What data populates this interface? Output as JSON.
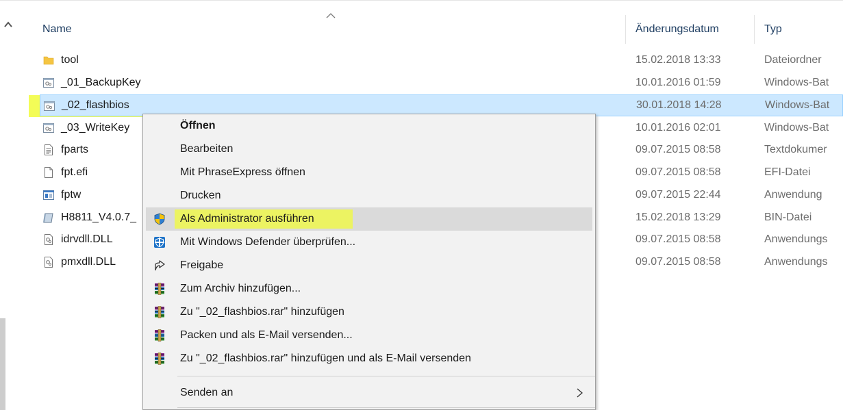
{
  "header": {
    "name": "Name",
    "date": "Änderungsdatum",
    "type": "Typ"
  },
  "files": [
    {
      "name": "tool",
      "date": "15.02.2018 13:33",
      "type": "Dateiordner",
      "icon": "folder-icon"
    },
    {
      "name": "_01_BackupKey",
      "date": "10.01.2016 01:59",
      "type": "Windows-Bat",
      "icon": "batch-file-icon"
    },
    {
      "name": "_02_flashbios",
      "date": "30.01.2018 14:28",
      "type": "Windows-Bat",
      "icon": "batch-file-icon",
      "selected": true
    },
    {
      "name": "_03_WriteKey",
      "date": "10.01.2016 02:01",
      "type": "Windows-Bat",
      "icon": "batch-file-icon"
    },
    {
      "name": "fparts",
      "date": "09.07.2015 08:58",
      "type": "Textdokumer",
      "icon": "text-file-icon"
    },
    {
      "name": "fpt.efi",
      "date": "09.07.2015 08:58",
      "type": "EFI-Datei",
      "icon": "blank-file-icon"
    },
    {
      "name": "fptw",
      "date": "09.07.2015 22:44",
      "type": "Anwendung",
      "icon": "application-icon"
    },
    {
      "name": "H8811_V4.0.7_",
      "date": "15.02.2018 13:29",
      "type": "BIN-Datei",
      "icon": "bin-file-icon"
    },
    {
      "name": "idrvdll.DLL",
      "date": "09.07.2015 08:58",
      "type": "Anwendungs",
      "icon": "dll-file-icon"
    },
    {
      "name": "pmxdll.DLL",
      "date": "09.07.2015 08:58",
      "type": "Anwendungs",
      "icon": "dll-file-icon"
    }
  ],
  "context_menu": {
    "open": "Öffnen",
    "edit": "Bearbeiten",
    "phraseexpress": "Mit PhraseExpress öffnen",
    "print": "Drucken",
    "run_as_admin": "Als Administrator ausführen",
    "defender": "Mit Windows Defender überprüfen...",
    "share": "Freigabe",
    "add_archive": "Zum Archiv hinzufügen...",
    "add_rar": "Zu \"_02_flashbios.rar\" hinzufügen",
    "pack_email": "Packen und als E-Mail versenden...",
    "add_rar_email": "Zu \"_02_flashbios.rar\" hinzufügen und als E-Mail versenden",
    "send_to": "Senden an"
  },
  "colors": {
    "selection": "#cce8ff",
    "highlighter": "#f1fb3a",
    "menu_bg": "#f2f2f2",
    "menu_hover": "#dadada"
  }
}
